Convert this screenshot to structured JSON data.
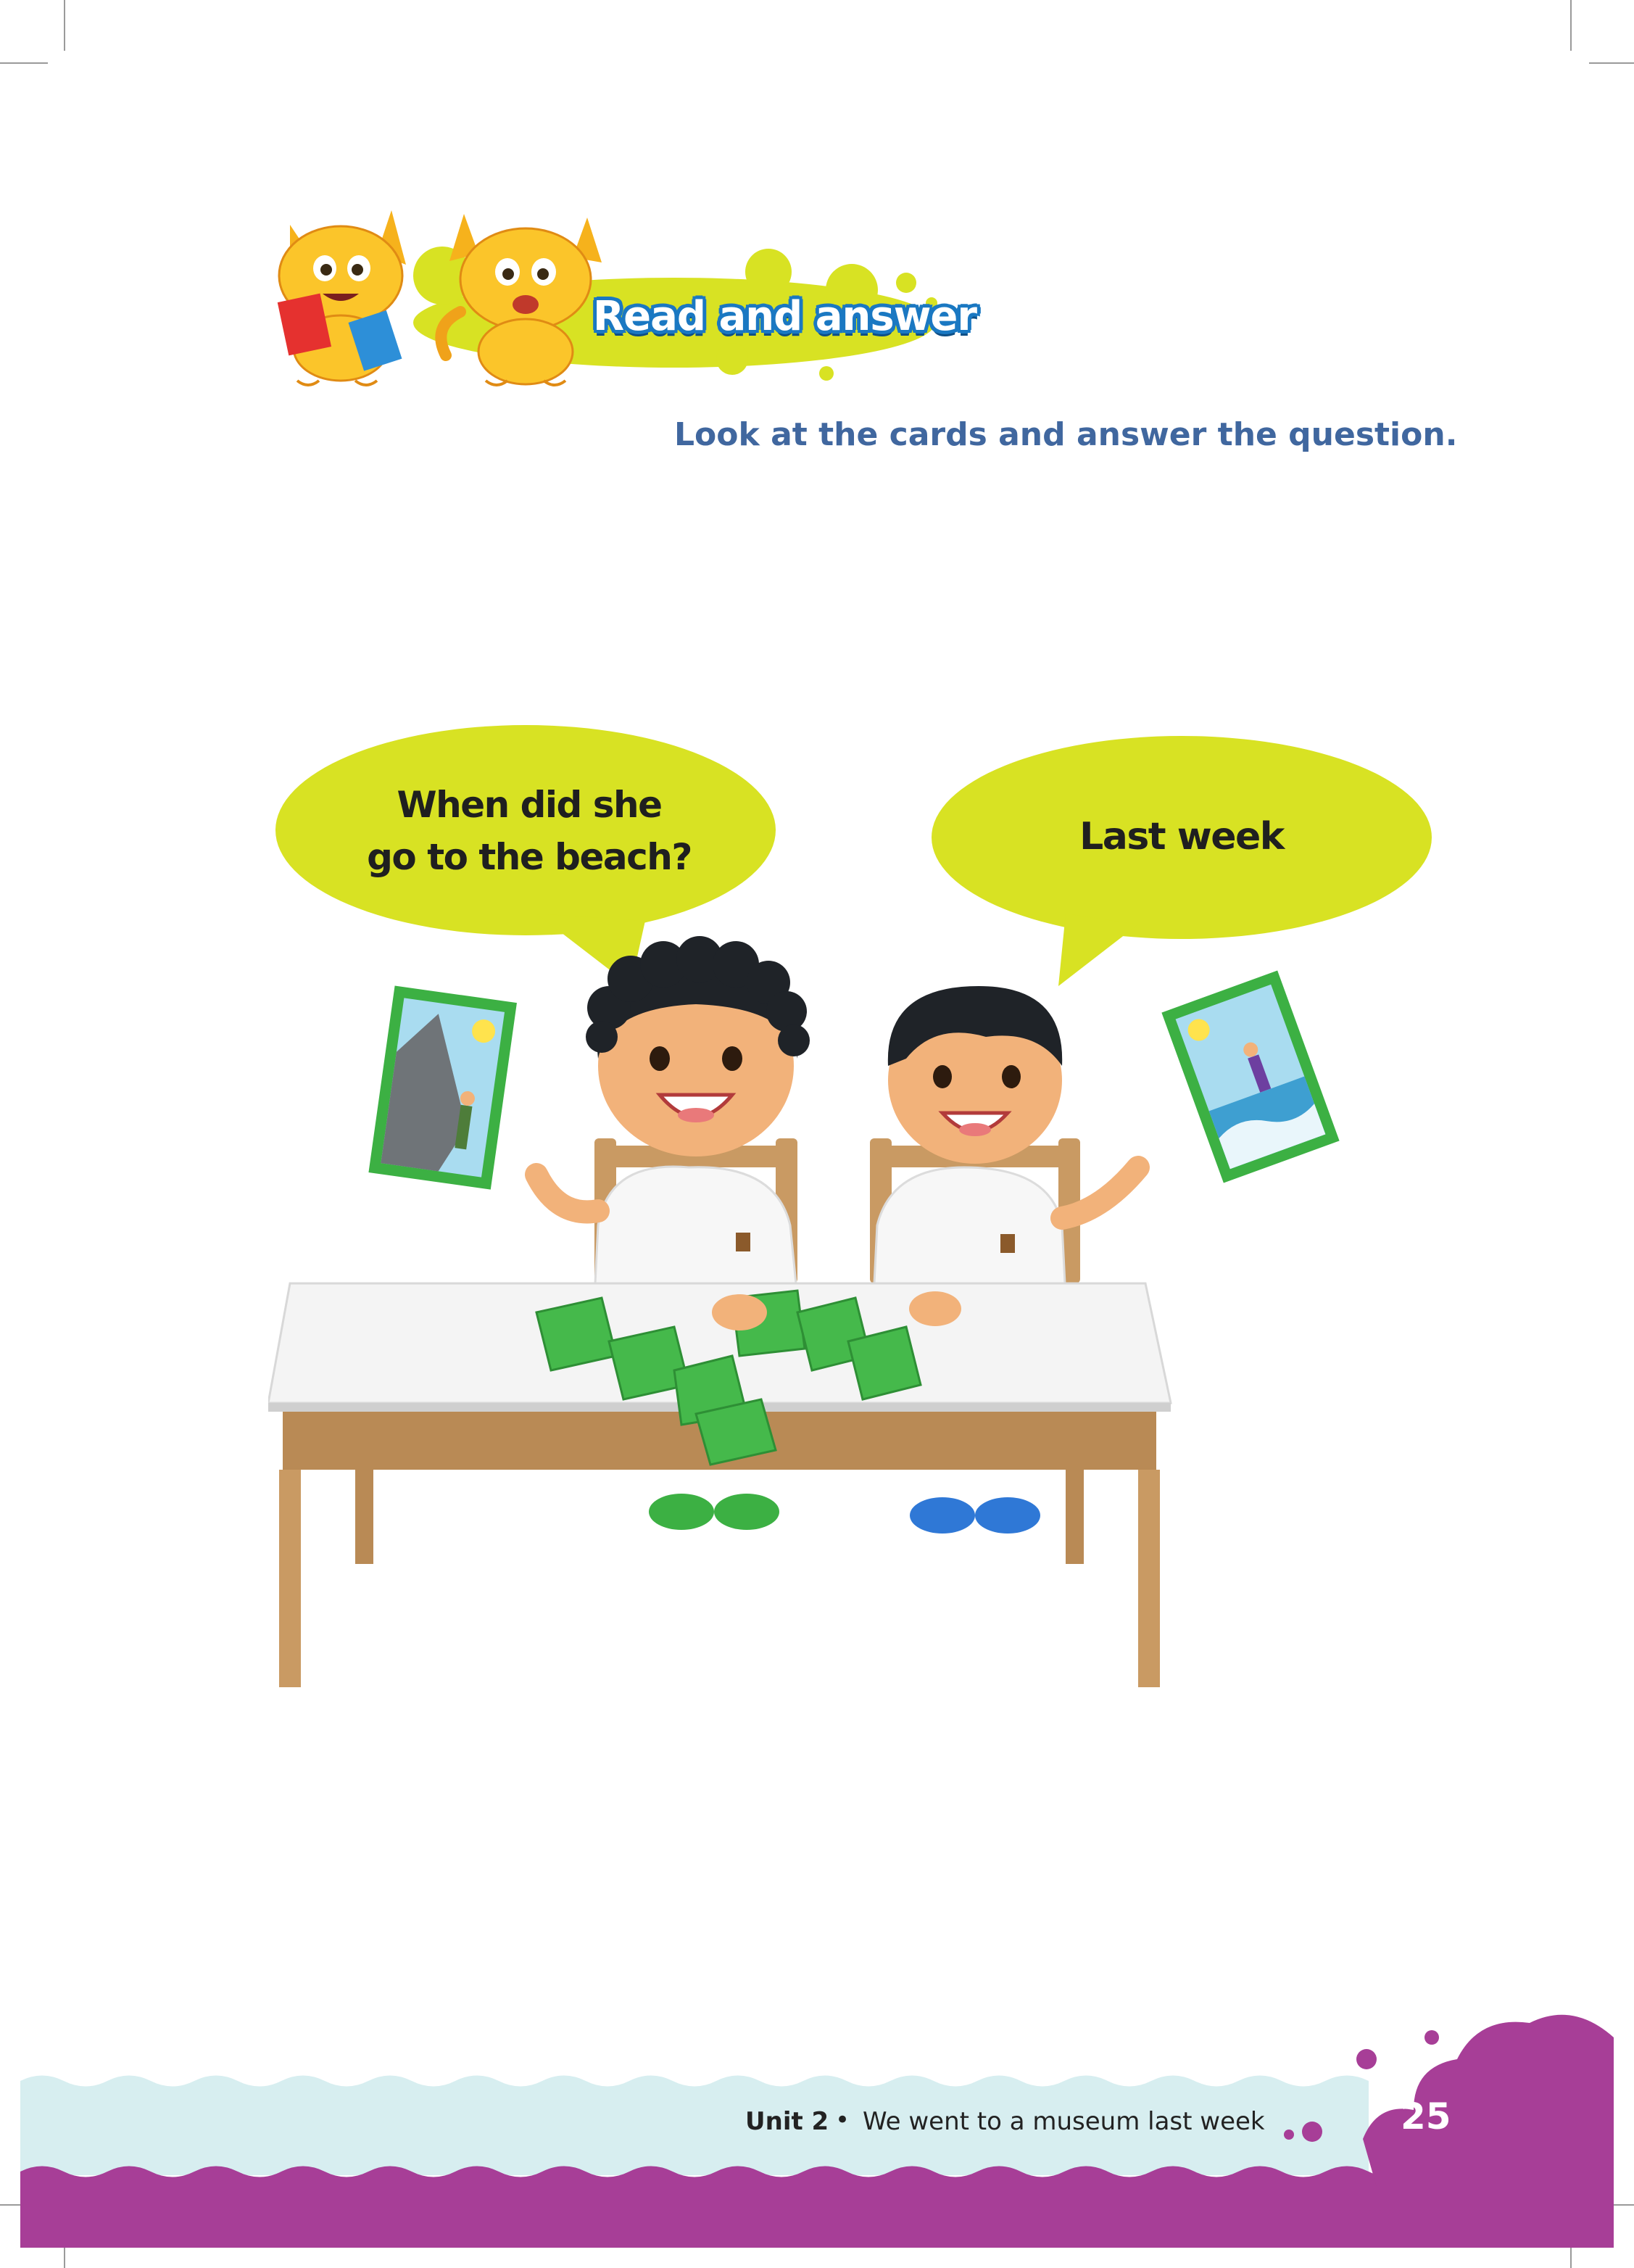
{
  "header": {
    "title": "Read and answer"
  },
  "instruction": "Look at the cards and answer the question.",
  "bubbles": {
    "question_line1": "When did she",
    "question_line2": "go to the beach?",
    "answer": "Last week"
  },
  "footer": {
    "unit": "Unit 2",
    "separator": "•",
    "title": "We went to a museum last week",
    "page_number": "25"
  },
  "colors": {
    "bubble": "#d8e223",
    "instruction": "#40679f",
    "footer_purple": "#a73e97",
    "footer_wave": "#d7eef0",
    "card_green": "#3cb043"
  }
}
